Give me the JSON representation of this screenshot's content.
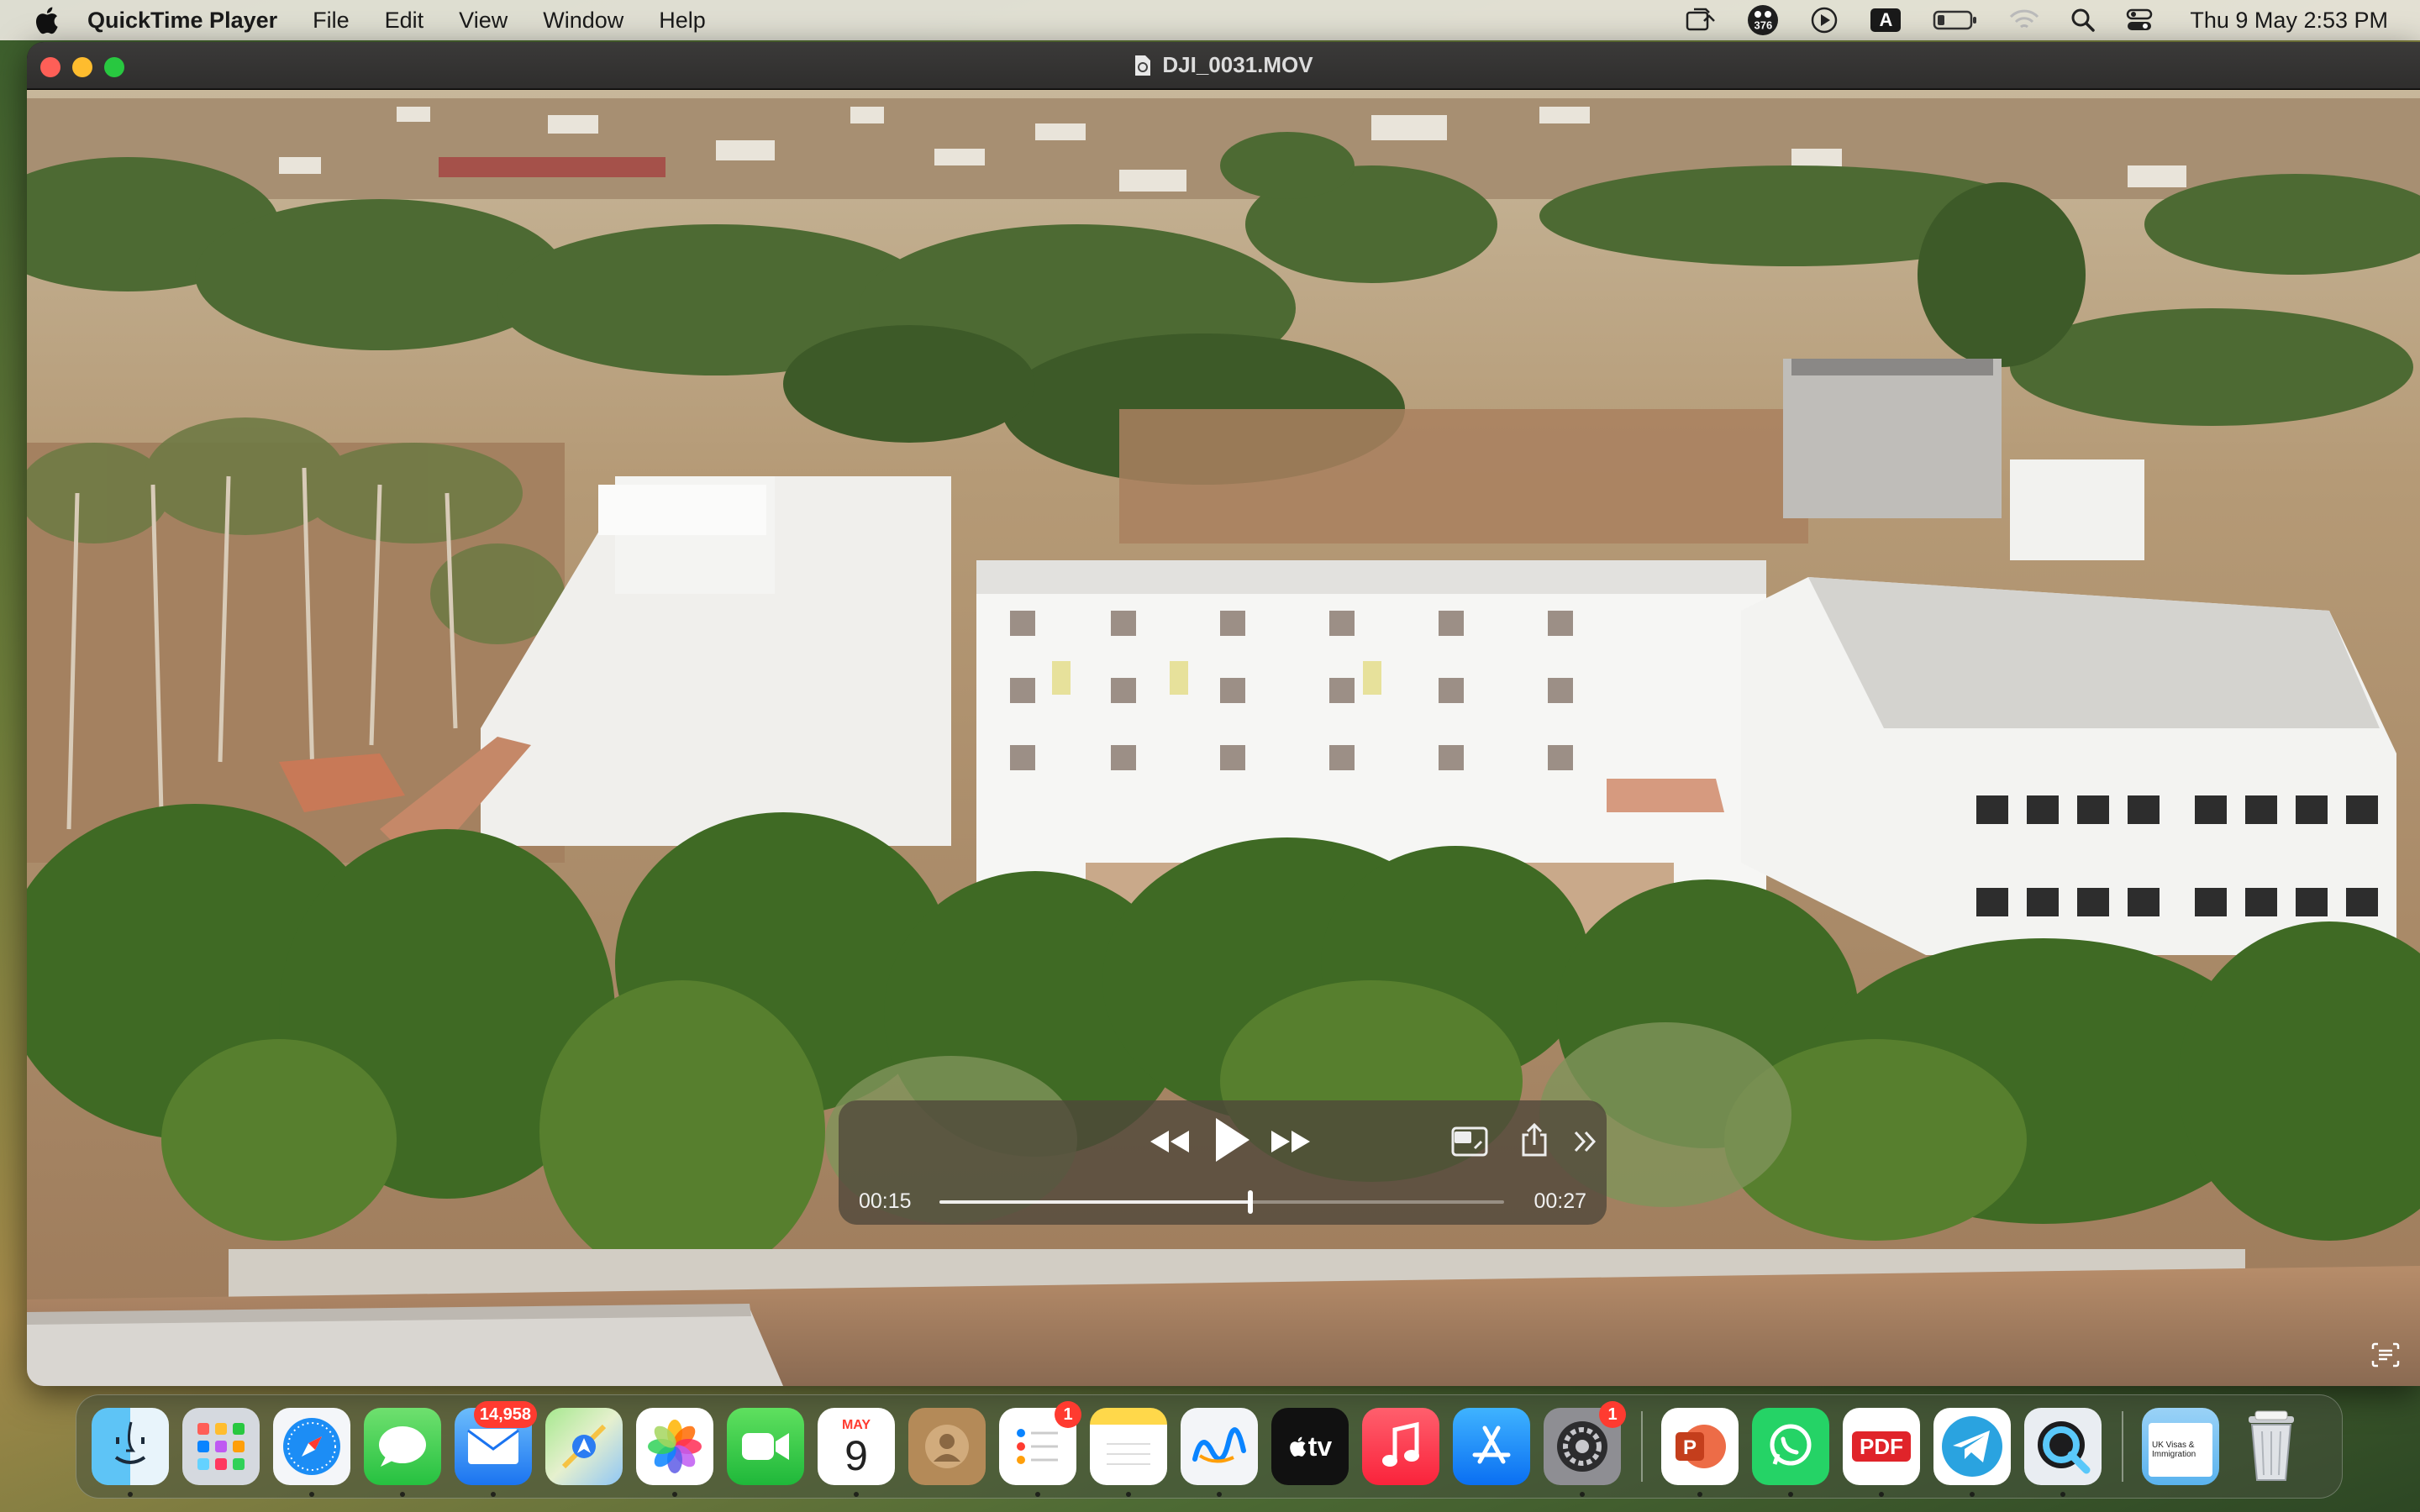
{
  "menubar": {
    "app_name": "QuickTime Player",
    "menus": [
      "File",
      "Edit",
      "View",
      "Window",
      "Help"
    ],
    "status_badge": "376",
    "keyboard_letter": "A",
    "clock": "Thu 9 May  2:53 PM"
  },
  "window": {
    "title": "DJI_0031.MOV"
  },
  "player": {
    "elapsed": "00:15",
    "remaining": "00:27",
    "progress_fraction": 0.55
  },
  "dock": {
    "mail_badge": "14,958",
    "calendar_month": "MAY",
    "calendar_day": "9",
    "reminders_badge": "1",
    "settings_badge": "1",
    "tv_label": "tv",
    "pdf_label": "PDF",
    "folder_label": "UK Visas & Immigration"
  },
  "colors": {
    "accent": "#0a84ff",
    "close": "#fe5f57",
    "minimize": "#febc2e",
    "zoom": "#28c840",
    "badge": "#ff3b30"
  }
}
